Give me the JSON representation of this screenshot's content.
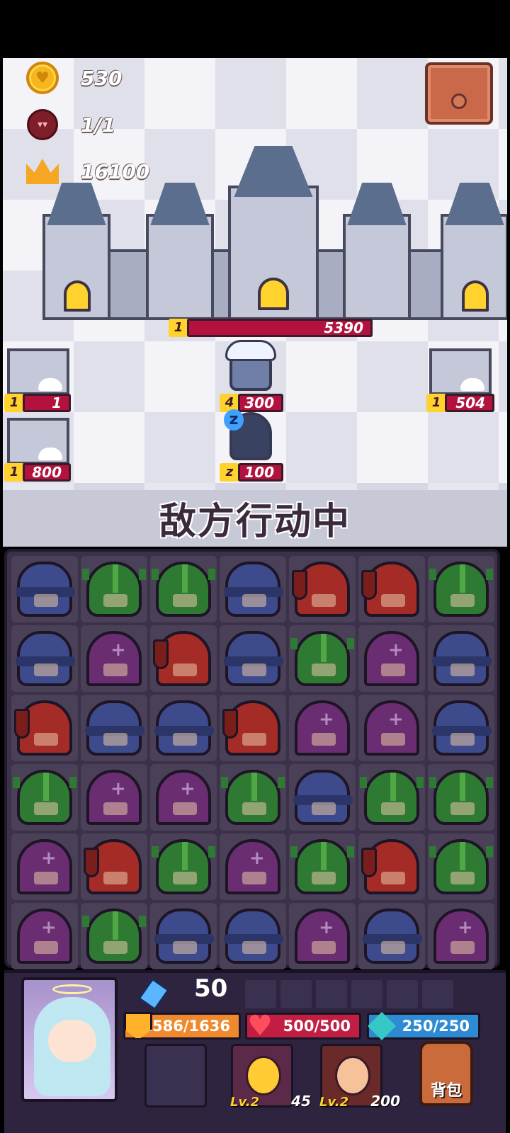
{
  "stats": {
    "gold": "530",
    "enemies": "1/1",
    "score": "16100"
  },
  "castle": {
    "level": "1",
    "hp": "5390"
  },
  "forts": [
    {
      "level": "1",
      "hp": "1"
    },
    {
      "level": "1",
      "hp": "800"
    },
    {
      "level": "1",
      "hp": "504"
    }
  ],
  "units": [
    {
      "level": "4",
      "hp": "300"
    },
    {
      "level": "z",
      "hp": "100"
    }
  ],
  "banner": "敌方行动中",
  "board": [
    [
      "mage",
      "orc",
      "orc",
      "mage",
      "warrior",
      "warrior",
      "orc"
    ],
    [
      "mage",
      "priest",
      "warrior",
      "mage",
      "orc",
      "priest",
      "mage"
    ],
    [
      "warrior",
      "mage",
      "mage",
      "warrior",
      "priest",
      "priest",
      "mage"
    ],
    [
      "orc",
      "priest",
      "priest",
      "orc",
      "mage",
      "orc",
      "orc"
    ],
    [
      "priest",
      "warrior",
      "orc",
      "priest",
      "orc",
      "warrior",
      "orc"
    ],
    [
      "priest",
      "orc",
      "mage",
      "mage",
      "priest",
      "mage",
      "priest"
    ]
  ],
  "hud": {
    "energy": "50",
    "armor": "1586/1636",
    "health": "500/500",
    "mana": "250/250",
    "skills": [
      {
        "level": "Lv.2",
        "cost": "45"
      },
      {
        "level": "Lv.2",
        "cost": "200"
      }
    ],
    "bag_label": "背包"
  },
  "icons": [
    "coin-icon",
    "demon-icon",
    "crown-icon",
    "chest-icon",
    "energy-crystal-icon",
    "shield-icon",
    "heart-icon",
    "diamond-icon",
    "backpack-icon"
  ]
}
